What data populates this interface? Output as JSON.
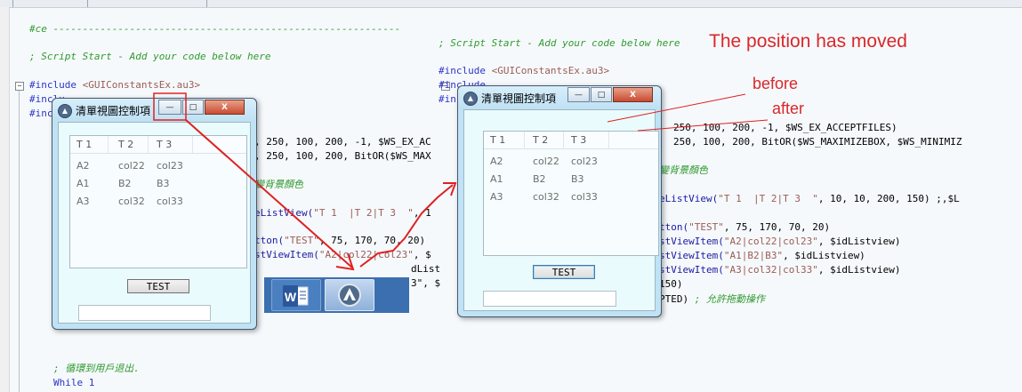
{
  "annotations": {
    "headline": "The position has moved",
    "before": "before",
    "after": "after"
  },
  "editor": {
    "left_code": {
      "l1": "#ce -----------------------------------------------------------",
      "l2": "; Script Start - Add your code below here",
      "inc_kw": "#include",
      "inc1": "<GUIConstantsEx.au3>",
      "inc2_kw": "#inclu",
      "inc3_kw": "#inc",
      "r1": ", 250, 100, 200, -1, $WS_EX_AC",
      "r2": ", 250, 100, 200, BitOR($WS_MAX",
      "r3": "變背景顏色",
      "r4a": "eListView(",
      "r4b": "\"T 1  |T 2|T 3  \"",
      "r4c": ", 1",
      "r5a": "tton(",
      "r5b": "\"TEST\"",
      "r5c": ", 75, 170, 70, 20)",
      "r6a": "stViewItem(",
      "r6b": "\"A2|col22|col23\"",
      "r6c": ", $",
      "r7": "dList",
      "r8": "3\", $",
      "comment_cn": "; 循環到用戶退出.",
      "while": "While 1"
    },
    "right_code": {
      "l1": "; Script Start - Add your code below here",
      "inc1": "<GUIConstantsEx.au3>",
      "inc2": "#include",
      "inc3": "#inc",
      "r1": "250, 100, 200, -1, $WS_EX_ACCEPTFILES)",
      "r2": "250, 100, 200, BitOR($WS_MAXIMIZEBOX, $WS_MINIMIZ",
      "r3": "變背景顏色",
      "r4a": "eListView(",
      "r4b": "\"T 1  |T 2|T 3  \"",
      "r4c": ", 10, 10, 200, 150) ;,$L",
      "r5a": "tton(",
      "r5b": "\"TEST\"",
      "r5c": ", 75, 170, 70, 20)",
      "r6a": "stViewItem(",
      "r6b": "\"A2|col22|col23\"",
      "r6c": ", $idListview)",
      "r7a": "stViewItem(",
      "r7b": "\"A1|B2|B3\"",
      "r7c": ", $idListview)",
      "r8a": "stViewItem(",
      "r8b": "\"A3|col32|col33\"",
      "r8c": ", $idListview)",
      "r9": "150)",
      "r10a": "PTED)",
      "r10b": " ; 允許拖動操作"
    }
  },
  "window": {
    "title": "清單視圖控制項",
    "min": "—",
    "max": "□",
    "close": "X",
    "columns": [
      "T 1",
      "T 2",
      "T 3"
    ],
    "rows": [
      [
        "A2",
        "col22",
        "col23"
      ],
      [
        "A1",
        "B2",
        "B3"
      ],
      [
        "A3",
        "col32",
        "col33"
      ]
    ],
    "button": "TEST",
    "input_value": ""
  },
  "taskbar": {
    "items": [
      "word-icon",
      "autoit-icon"
    ],
    "word_letter": "W"
  },
  "colors": {
    "annotation": "#d8282a",
    "comment": "#2e9a2e",
    "keyword": "#2a35c8",
    "string": "#9a5d55",
    "window_frame": "#bfe3f4"
  }
}
